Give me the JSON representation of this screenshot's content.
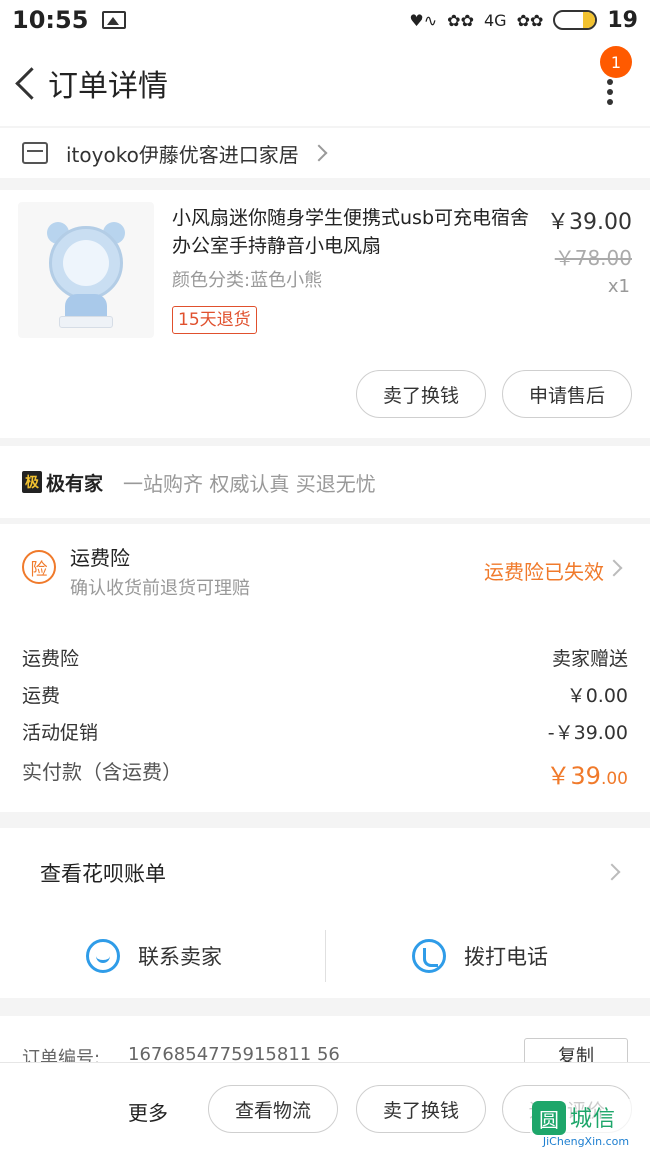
{
  "status_bar": {
    "time": "10:55",
    "network": "4G",
    "battery_level": 0.3,
    "battery": "19"
  },
  "header": {
    "title": "订单详情",
    "badge": "1"
  },
  "shop": {
    "name": "itoyoko伊藤优客进口家居"
  },
  "product": {
    "name": "小风扇迷你随身学生便携式usb可充电宿舍办公室手持静音小电风扇",
    "sku": "颜色分类:蓝色小熊",
    "tag": "15天退货",
    "price": "￥39.00",
    "original_price": "￥78.00",
    "quantity": "x1",
    "sell_button": "卖了换钱",
    "after_sale_button": "申请售后"
  },
  "jiyoujia": {
    "logo_mark": "极",
    "logo_text": "极有家",
    "slogan": "一站购齐 权威认真 买退无忧"
  },
  "insurance": {
    "icon_text": "险",
    "title": "运费险",
    "subtitle": "确认收货前退货可理赔",
    "status": "运费险已失效"
  },
  "fees": [
    {
      "label": "运费险",
      "value": "卖家赠送"
    },
    {
      "label": "运费",
      "value": "￥0.00"
    },
    {
      "label": "活动促销",
      "value": "-￥39.00"
    }
  ],
  "total": {
    "label": "实付款（含运费）",
    "value_main": "￥39",
    "value_decimal": ".00"
  },
  "huabei": {
    "label": "查看花呗账单",
    "contact_seller": "联系卖家",
    "call_phone": "拨打电话"
  },
  "order": {
    "label": "订单编号:",
    "number": "1676854775915811 56",
    "copy_button": "复制"
  },
  "bottom_bar": {
    "more": "更多",
    "logistics": "查看物流",
    "sell": "卖了换钱",
    "review": "追加评价"
  },
  "watermark": {
    "mark": "圆",
    "cn": "城信",
    "en": "JiChengXin.com"
  },
  "colors": {
    "accent": "#f07a2b",
    "badge": "#ff5a00",
    "link_blue": "#2f9ce8"
  }
}
